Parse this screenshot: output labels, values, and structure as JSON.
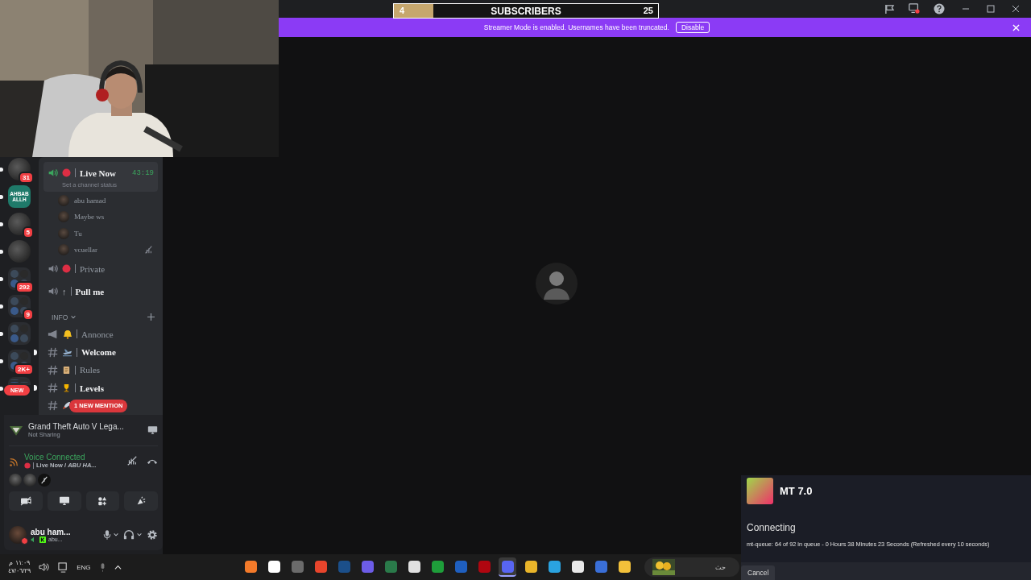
{
  "goal": {
    "current": "4",
    "label": "SUBSCRIBERS",
    "target": "25",
    "level": 0.15
  },
  "banner": {
    "text": "Streamer Mode is enabled. Usernames have been truncated.",
    "button": "Disable"
  },
  "servers": [
    {
      "kind": "avatar",
      "badge": "31",
      "unread": true
    },
    {
      "kind": "text",
      "label": "AHBAB ALLH",
      "unread": true
    },
    {
      "kind": "avatar",
      "badge": "5",
      "unread": true
    },
    {
      "kind": "avatar",
      "unread": true
    },
    {
      "kind": "folder",
      "badge": "292",
      "unread": true
    },
    {
      "kind": "folder",
      "badge": "9",
      "unread": true
    },
    {
      "kind": "folder",
      "unread": true
    },
    {
      "kind": "folder",
      "badge": "2K+",
      "unread": true
    },
    {
      "kind": "folder",
      "new_pill": "NEW",
      "unread": true
    }
  ],
  "channels": [
    {
      "kind": "voice",
      "name": "Live Now",
      "selected": true,
      "timer": "43:19",
      "status": "Set a channel status",
      "members": [
        {
          "name": "abu hamad",
          "muted": false
        },
        {
          "name": "Maybe ws",
          "muted": false
        },
        {
          "name": "Tu",
          "muted": false
        },
        {
          "name": "vcuellar",
          "muted": true
        }
      ]
    },
    {
      "kind": "voice",
      "name": "Private",
      "selected": false,
      "unread": false
    },
    {
      "kind": "voice",
      "prefix": "↑",
      "name": "Pull me",
      "selected": false,
      "unread": true
    },
    {
      "kind": "category",
      "name": "INFO",
      "expanded": true
    },
    {
      "kind": "announcement",
      "name": "Annonce",
      "selected": false,
      "unread": false
    },
    {
      "kind": "text",
      "name": "Welcome",
      "selected": false,
      "unread": true
    },
    {
      "kind": "text",
      "name": "Rules",
      "selected": false,
      "unread": false
    },
    {
      "kind": "text",
      "name": "Levels",
      "selected": false,
      "unread": true
    },
    {
      "kind": "text",
      "selected": false,
      "unread": false,
      "mention": "1 NEW MENTION"
    }
  ],
  "activity": {
    "game": "Grand Theft Auto V Lega...",
    "status": "Not Sharing"
  },
  "voice": {
    "title": "Voice Connected",
    "channel": "Live Now / *ABU HA...*",
    "members": [
      {
        "muted": false
      },
      {
        "muted": false
      },
      {
        "muted": true
      }
    ]
  },
  "user": {
    "name": "abu ham...",
    "status": "abu..."
  },
  "taskbar": {
    "time": "١١:٠٩ م",
    "date": "٤٧/٠٦/٢٩",
    "language": "ENG",
    "search": "حث",
    "apps": [
      {
        "selected": false
      },
      {
        "selected": false
      },
      {
        "selected": false
      },
      {
        "selected": false
      },
      {
        "selected": false
      },
      {
        "selected": false
      },
      {
        "selected": false
      },
      {
        "selected": false
      },
      {
        "selected": false
      },
      {
        "selected": false
      },
      {
        "selected": false
      },
      {
        "selected": true
      },
      {
        "selected": false
      },
      {
        "selected": false
      },
      {
        "selected": false
      },
      {
        "selected": false
      },
      {
        "selected": false
      }
    ]
  },
  "dialog": {
    "title": "MT 7.0",
    "status": "Connecting",
    "message": "mt-queue: 64 of 92 in queue - 0 Hours 38 Minutes 23 Seconds (Refreshed every 10 seconds)",
    "button": "Cancel"
  }
}
